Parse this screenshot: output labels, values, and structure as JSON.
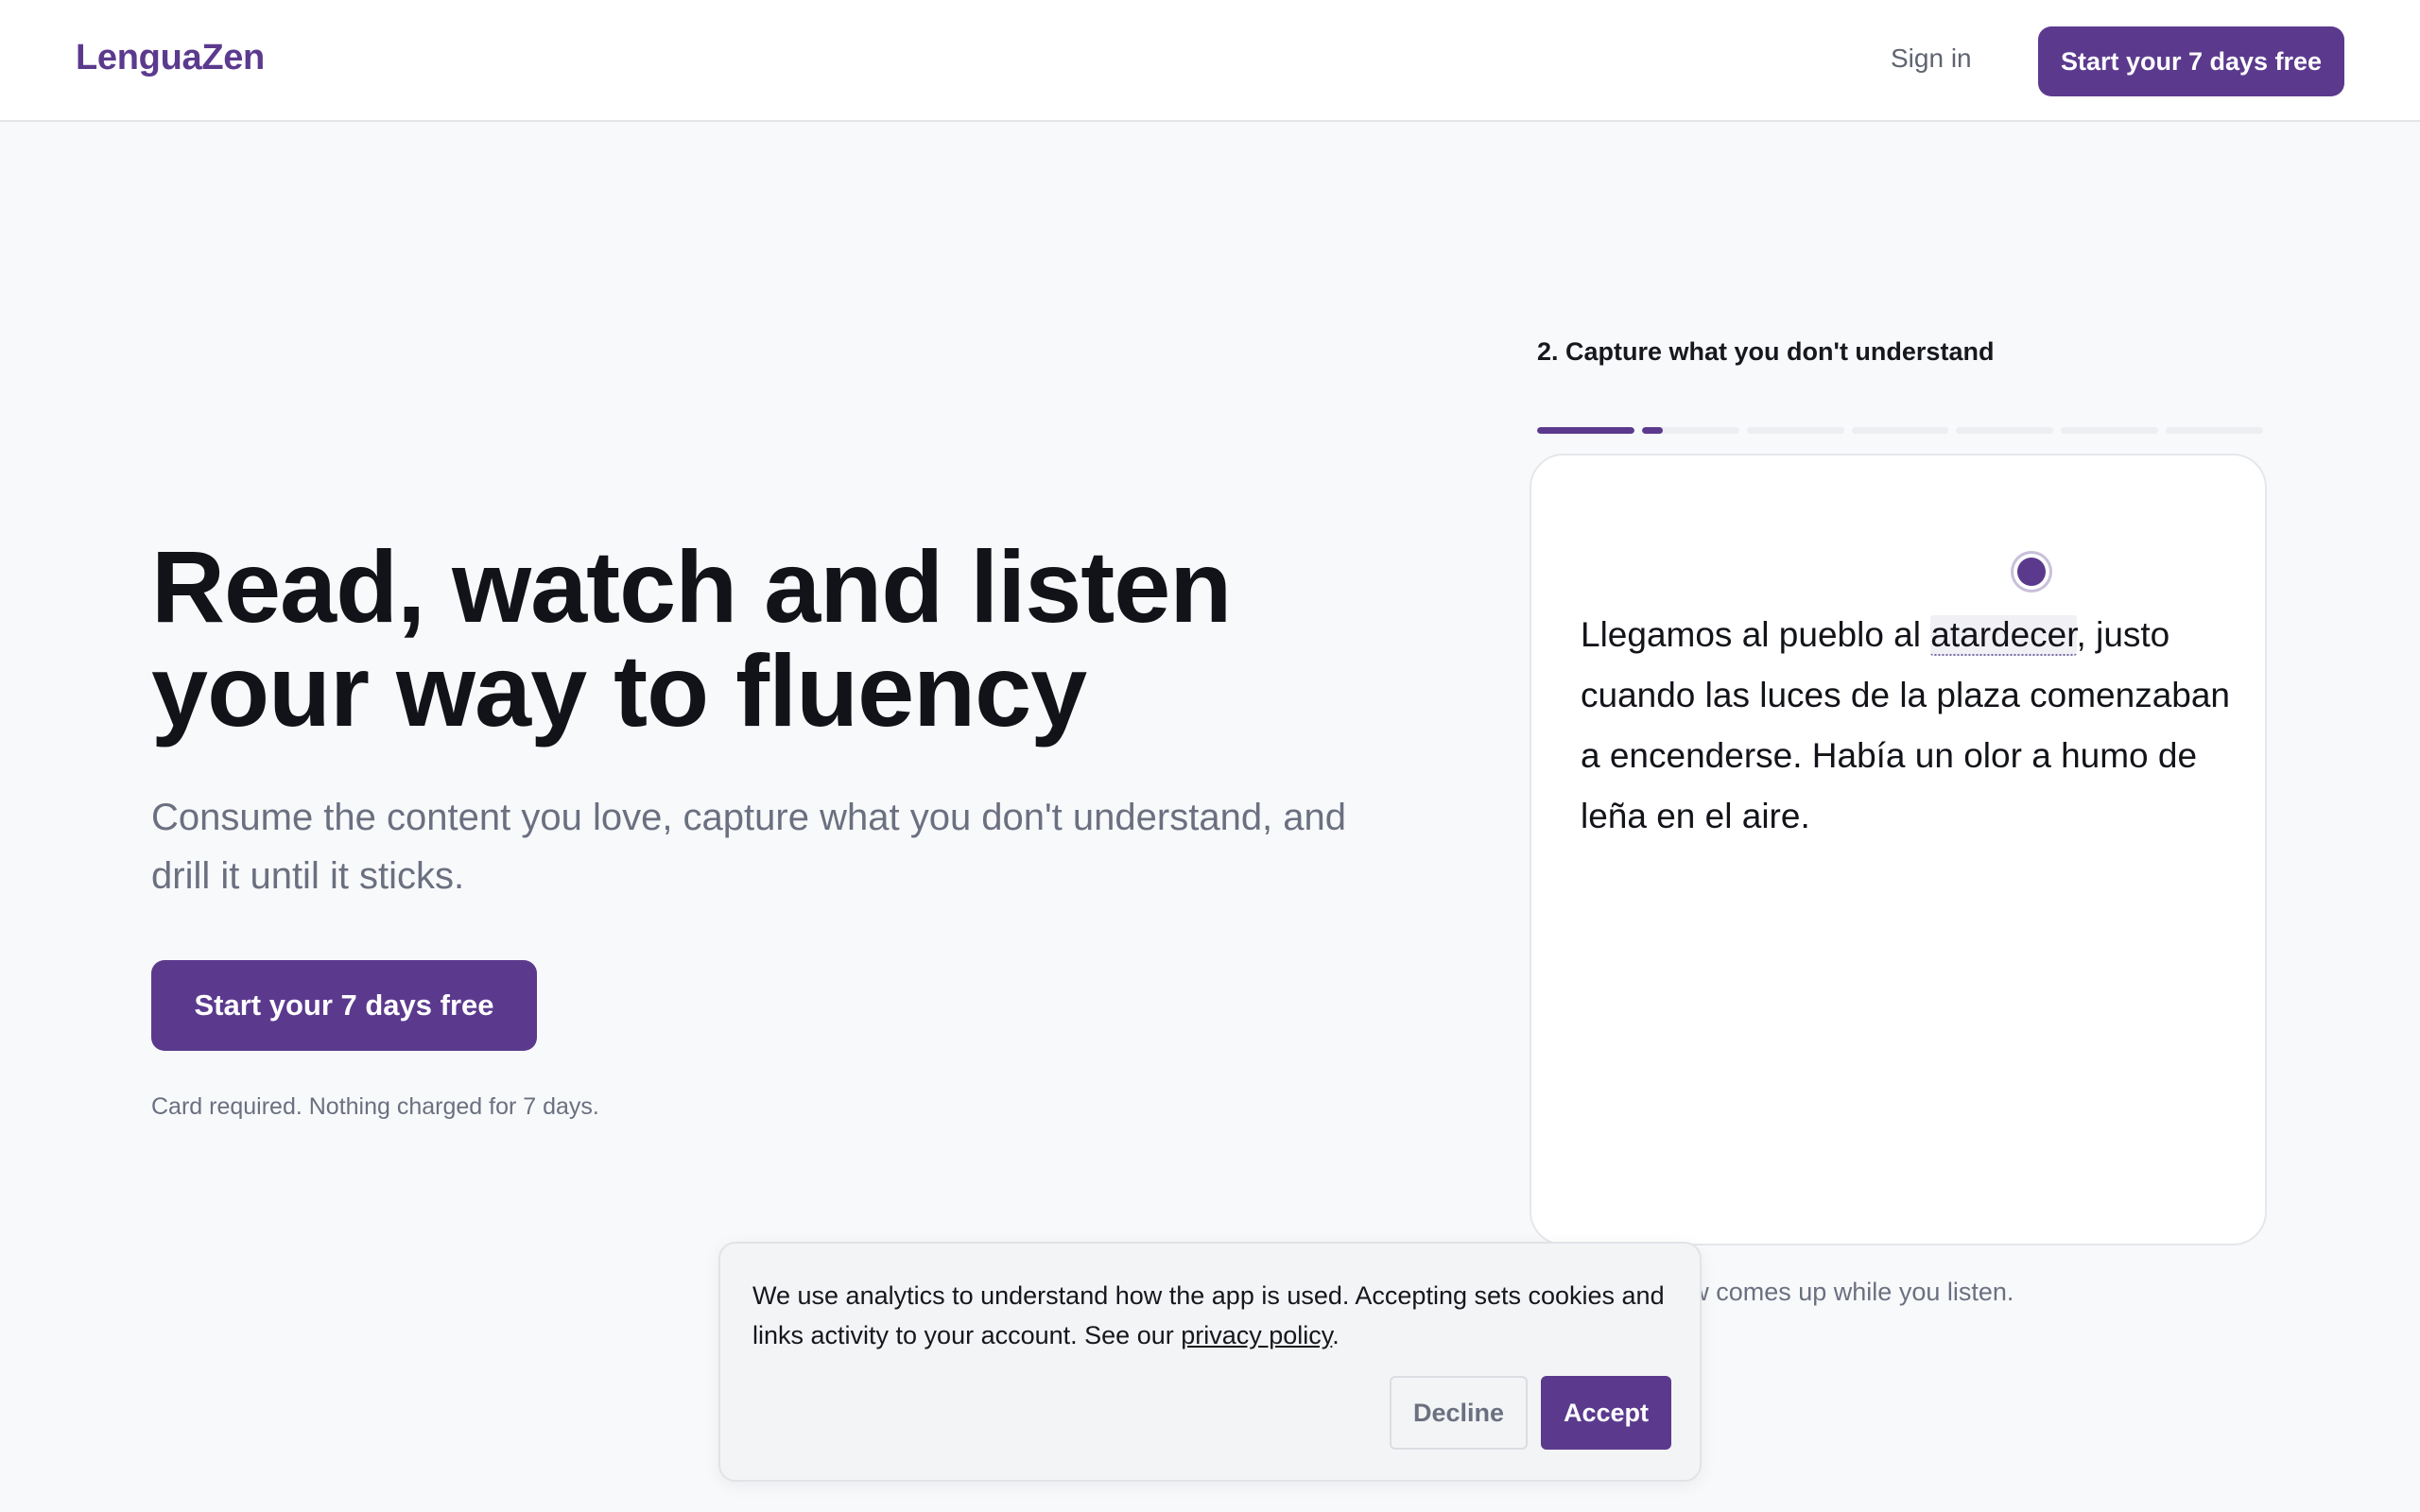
{
  "header": {
    "logo": "LenguaZen",
    "sign_in": "Sign in",
    "cta": "Start your 7 days free"
  },
  "hero": {
    "title_line1": "Read, watch and listen",
    "title_line2": "your way to fluency",
    "subtitle": "Consume the content you love, capture what you don't understand, and drill it until it sticks.",
    "cta": "Start your 7 days free",
    "note": "Card required. Nothing charged for 7 days."
  },
  "demo": {
    "step_title": "2. Capture what you don't understand",
    "progress": {
      "segments": 7,
      "segment_fill": [
        1,
        0.22,
        0,
        0,
        0,
        0,
        0
      ]
    },
    "passage": {
      "before": "Llegamos al pueblo al ",
      "highlight": "atardecer",
      "after": ", justo cuando las luces de la plaza comenzaban a encenderse. Había un olor a humo de leña en el aire."
    },
    "caption": "...on't know comes up while you listen."
  },
  "cookie_banner": {
    "text": "We use analytics to understand how the app is used. Accepting sets cookies and links activity to your account. See our ",
    "link": "privacy policy",
    "text_end": ".",
    "decline": "Decline",
    "accept": "Accept"
  },
  "colors": {
    "accent": "#5b3a8e",
    "background": "#f8f9fb",
    "muted_text": "#6b7080"
  }
}
